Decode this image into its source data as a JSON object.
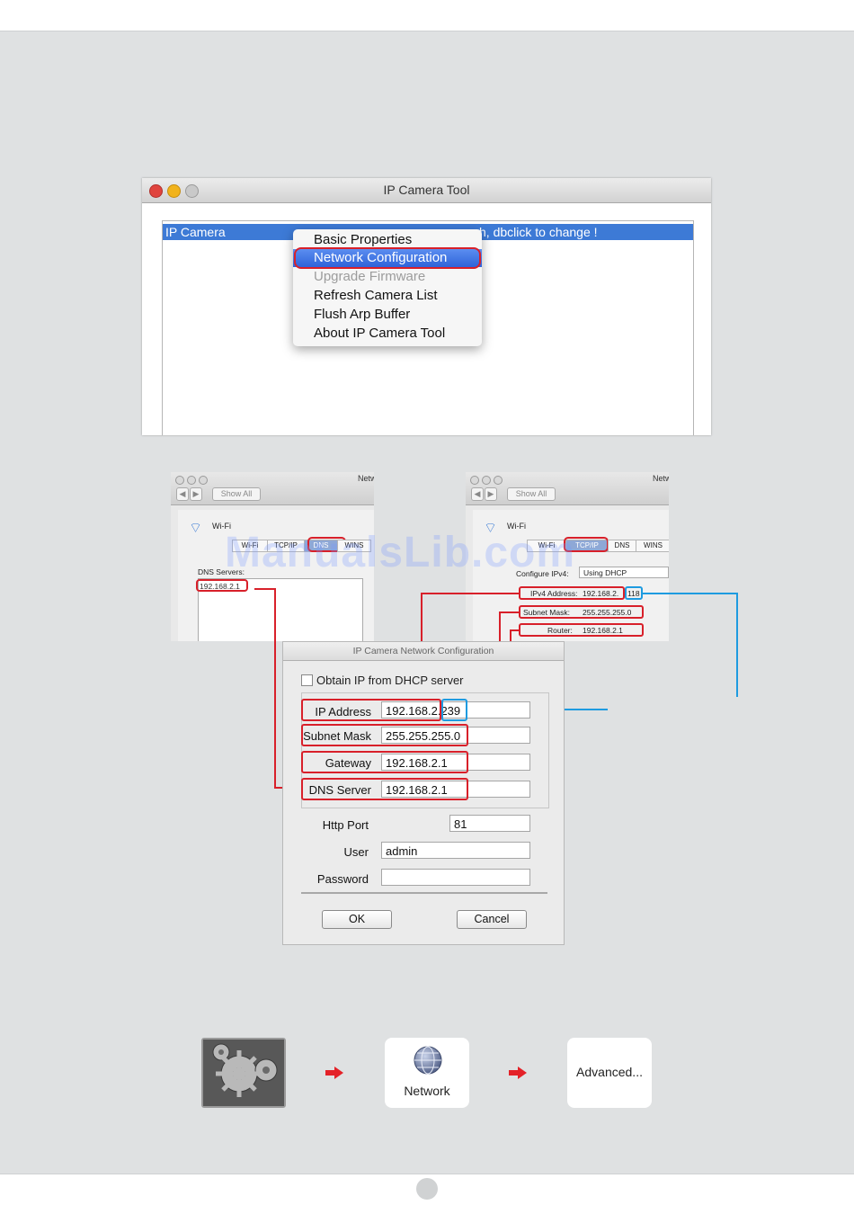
{
  "app_window": {
    "title": "IP Camera Tool",
    "list_row_left": "IP Camera",
    "list_row_right": "h, dbclick to change !"
  },
  "context_menu": {
    "items": [
      {
        "label": "Basic Properties",
        "state": "normal"
      },
      {
        "label": "Network Configuration",
        "state": "highlighted"
      },
      {
        "label": "Upgrade Firmware",
        "state": "disabled"
      },
      {
        "label": "Refresh Camera List",
        "state": "normal"
      },
      {
        "label": "Flush Arp Buffer",
        "state": "normal"
      },
      {
        "label": "About IP Camera Tool",
        "state": "normal"
      }
    ]
  },
  "network_prefs_left": {
    "title_partial": "Netw",
    "show_all": "Show All",
    "interface": "Wi-Fi",
    "tabs": [
      "Wi-Fi",
      "TCP/IP",
      "DNS",
      "WINS"
    ],
    "dns_label": "DNS Servers:",
    "dns_value": "192.168.2.1"
  },
  "network_prefs_right": {
    "title_partial": "Netw",
    "show_all": "Show All",
    "interface": "Wi-Fi",
    "tabs": [
      "Wi-Fi",
      "TCP/IP",
      "DNS",
      "WINS"
    ],
    "configure_label": "Configure IPv4:",
    "configure_value": "Using DHCP",
    "ipv4_label": "IPv4 Address:",
    "ipv4_prefix": "192.168.2.",
    "ipv4_suffix": "118",
    "subnet_label": "Subnet Mask:",
    "subnet_value": "255.255.255.0",
    "router_label": "Router:",
    "router_value": "192.168.2.1"
  },
  "config_dialog": {
    "title": "IP Camera Network Configuration",
    "dhcp_label": "Obtain IP from DHCP server",
    "ip_label": "IP Address",
    "ip_prefix": "192.168.2.",
    "ip_suffix": "239",
    "mask_label": "Subnet Mask",
    "mask_value": "255.255.255.0",
    "gateway_label": "Gateway",
    "gateway_value": "192.168.2.1",
    "dns_label": "DNS Server",
    "dns_value": "192.168.2.1",
    "port_label": "Http Port",
    "port_value": "81",
    "user_label": "User",
    "user_value": "admin",
    "password_label": "Password",
    "password_value": "",
    "ok_label": "OK",
    "cancel_label": "Cancel"
  },
  "steps": {
    "network_label": "Network",
    "advanced_label": "Advanced..."
  },
  "watermark": "ManualsLib.com",
  "colors": {
    "highlight_red": "#d8202a",
    "highlight_blue": "#1e9be0",
    "selection_blue": "#3d7ad6",
    "arrow_red": "#e42128"
  }
}
